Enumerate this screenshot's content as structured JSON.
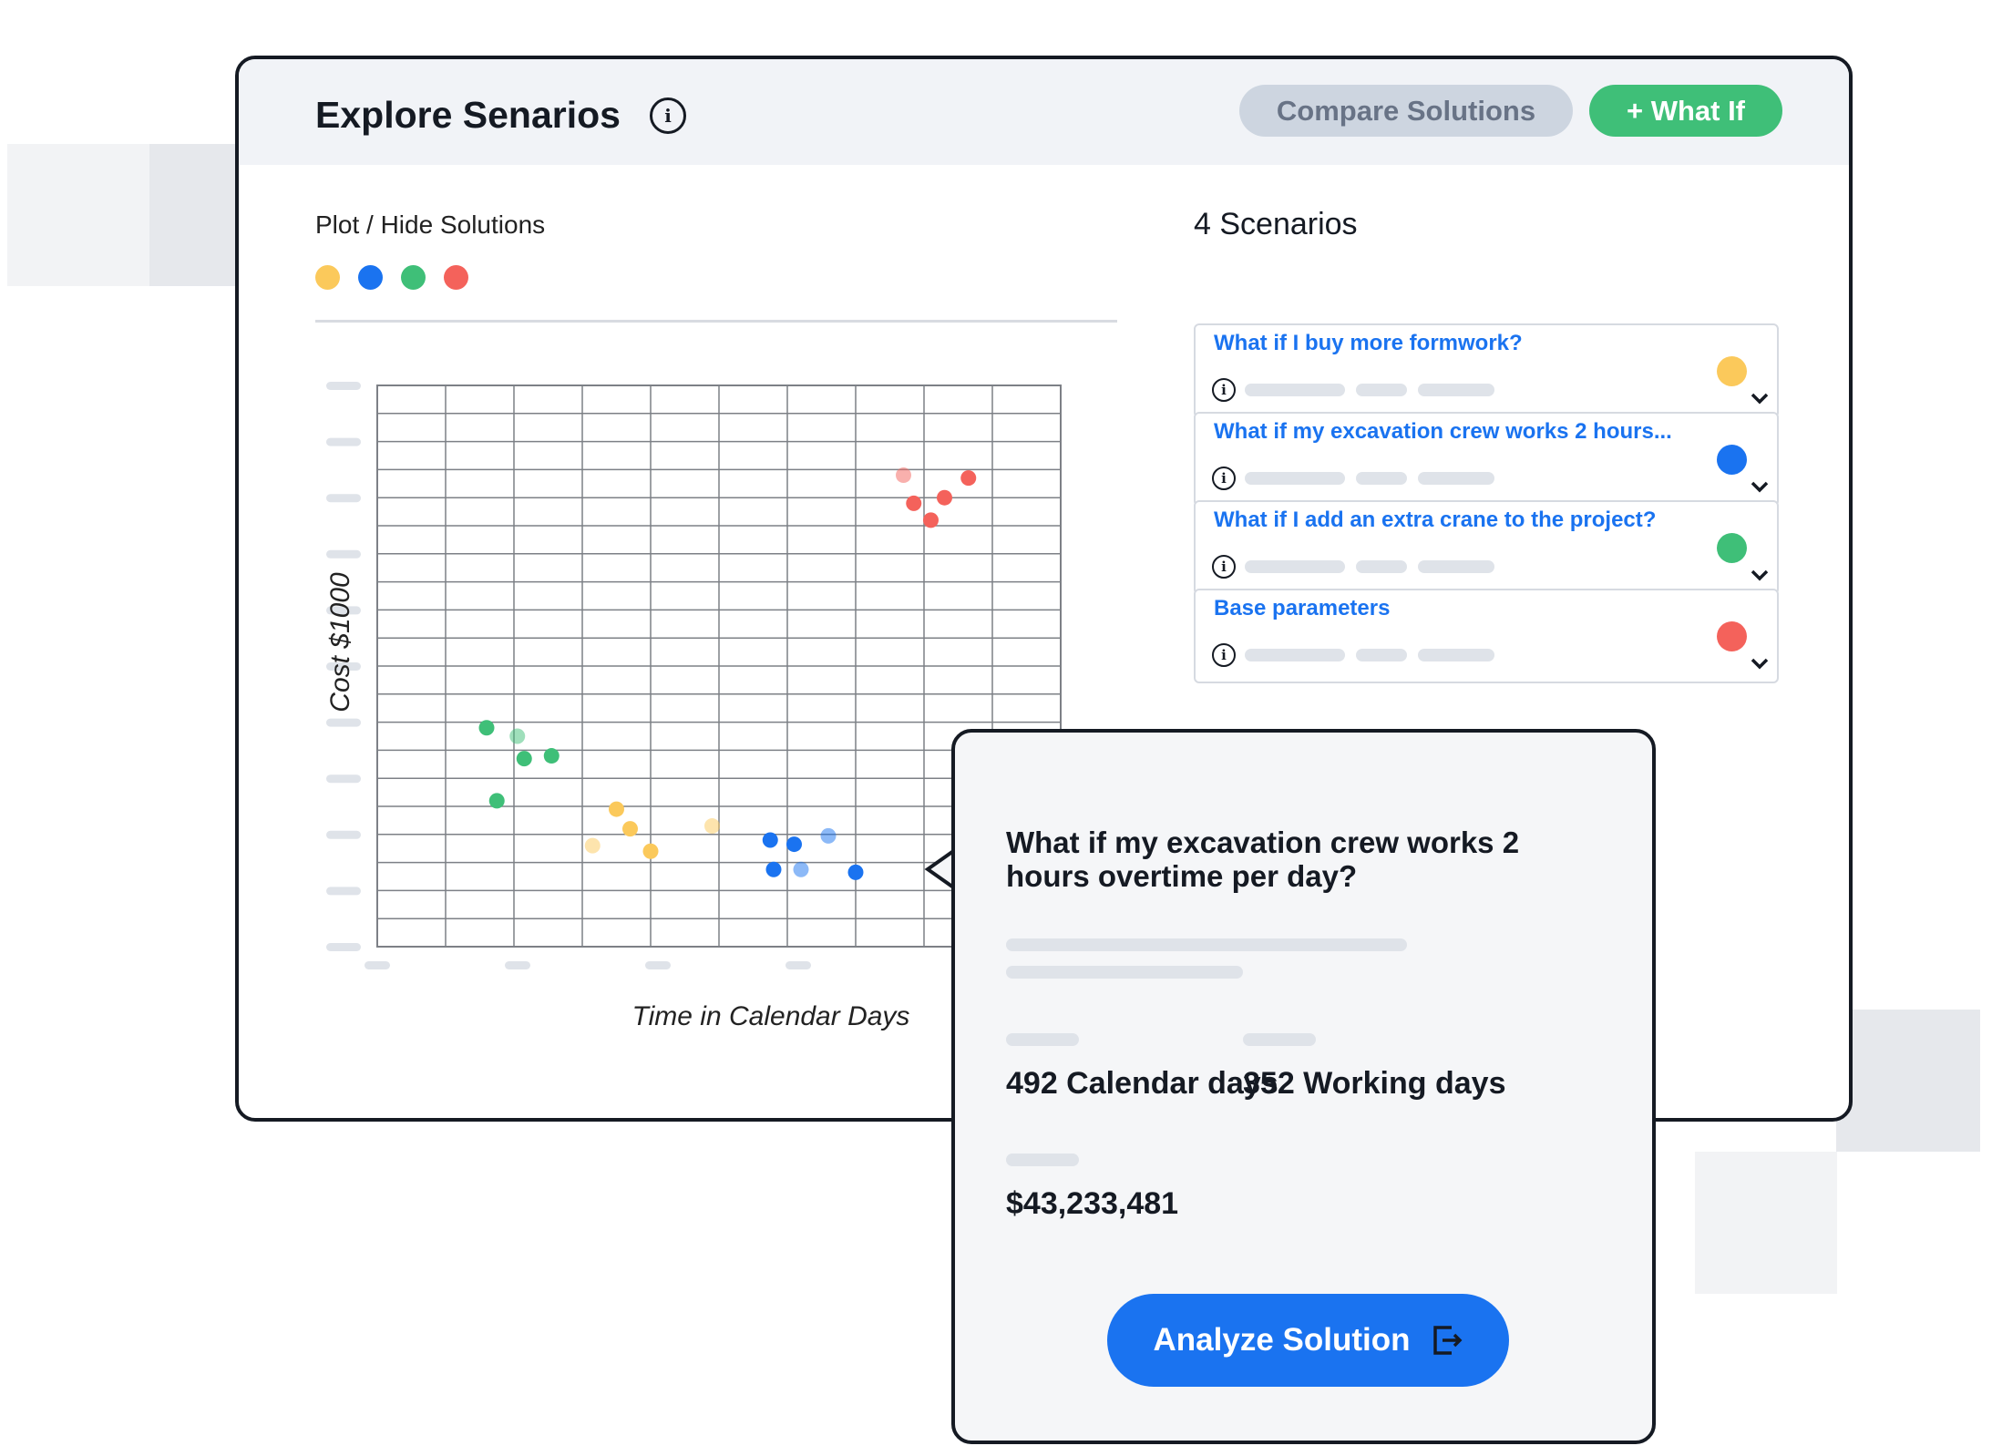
{
  "header": {
    "title": "Explore Senarios",
    "compare_label": "Compare Solutions",
    "whatif_label": "+ What If"
  },
  "plot": {
    "toggle_label": "Plot / Hide Solutions",
    "legend_colors": [
      "#fbc95b",
      "#1a73f0",
      "#3fbf78",
      "#f4625b"
    ]
  },
  "chart_data": {
    "type": "scatter",
    "xlabel": "Time in Calendar Days",
    "ylabel": "Cost $1000",
    "grid": true,
    "xlim": [
      0,
      10
    ],
    "ylim": [
      0,
      20
    ],
    "tick_labels": "placeholder bars (no values shown)",
    "series": [
      {
        "color": "#3fbf78",
        "points": [
          [
            1.6,
            7.8
          ],
          [
            2.05,
            7.5
          ],
          [
            2.15,
            6.7
          ],
          [
            2.55,
            6.8
          ],
          [
            1.75,
            5.2
          ]
        ],
        "faded": [
          1
        ]
      },
      {
        "color": "#fbc95b",
        "points": [
          [
            3.5,
            4.9
          ],
          [
            3.7,
            4.2
          ],
          [
            4.0,
            3.4
          ],
          [
            4.9,
            4.3
          ],
          [
            3.15,
            3.6
          ]
        ],
        "faded": [
          3,
          4
        ]
      },
      {
        "color": "#1a73f0",
        "points": [
          [
            5.75,
            3.8
          ],
          [
            6.1,
            3.65
          ],
          [
            6.6,
            3.95
          ],
          [
            5.8,
            2.75
          ],
          [
            6.2,
            2.75
          ],
          [
            7.0,
            2.65
          ]
        ],
        "faded": [
          2,
          4
        ]
      },
      {
        "color": "#f4625b",
        "points": [
          [
            7.7,
            16.8
          ],
          [
            7.85,
            15.8
          ],
          [
            8.3,
            16.0
          ],
          [
            8.1,
            15.2
          ],
          [
            8.65,
            16.7
          ]
        ],
        "faded": [
          0
        ]
      }
    ]
  },
  "scenarios": {
    "count_label": "4 Scenarios",
    "items": [
      {
        "title": "What if I buy more formwork?",
        "color": "#fbc95b"
      },
      {
        "title": "What if my excavation crew works 2 hours...",
        "color": "#1a73f0"
      },
      {
        "title": "What if I add an extra crane to the project?",
        "color": "#3fbf78"
      },
      {
        "title": "Base parameters",
        "color": "#f4625b"
      }
    ]
  },
  "popup": {
    "question": "What if my excavation crew works 2 hours overtime per day?",
    "calendar_days": "492 Calendar days",
    "working_days": "352 Working days",
    "cost": "$43,233,481",
    "analyze_label": "Analyze Solution"
  },
  "icons": {
    "info": "info-circle-icon",
    "expand": "chevron-down-icon",
    "analyze": "export-arrow-icon"
  }
}
